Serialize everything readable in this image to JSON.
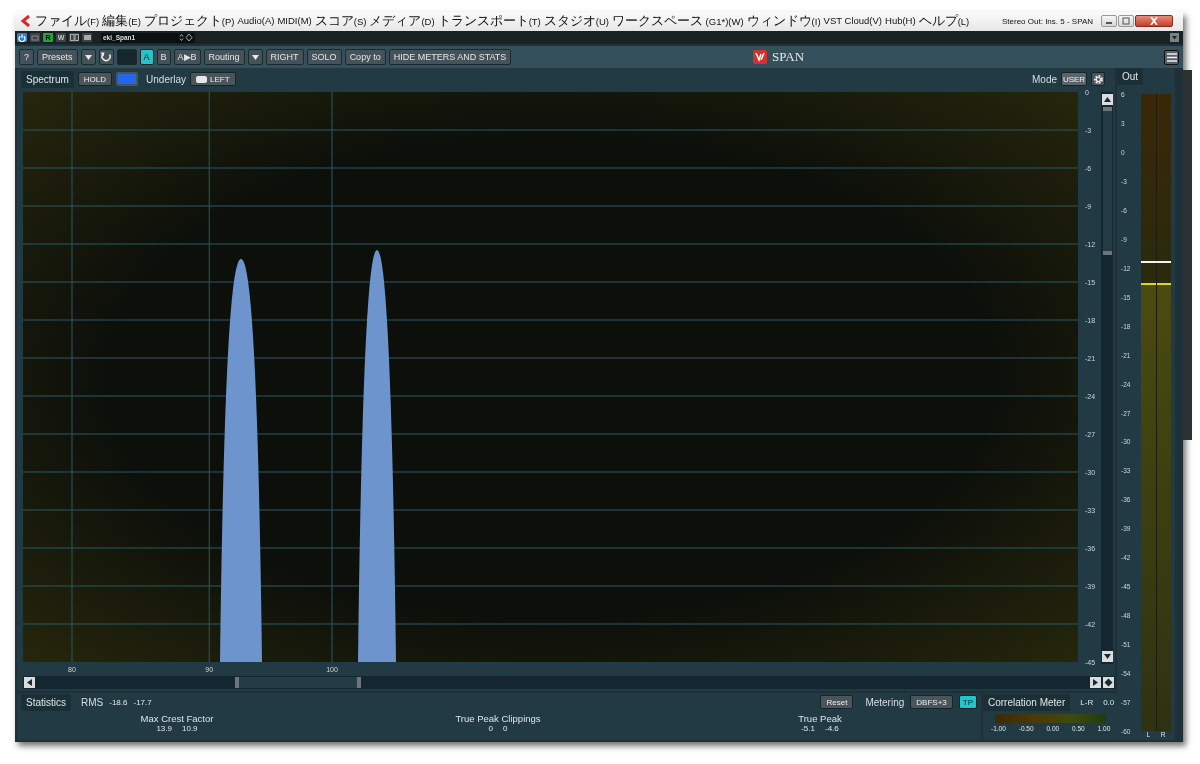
{
  "menu_bar": {
    "items": [
      "ファイル(F)",
      "編集(E)",
      "プロジェクト(P)",
      "Audio(A)",
      "MIDI(M)",
      "スコア(S)",
      "メディア(D)",
      "トランスポート(T)",
      "スタジオ(U)",
      "ワークスペース (G1*)(W)",
      "ウィンドウ(I)",
      "VST Cloud(V)",
      "Hub(H)",
      "ヘルプ(L)"
    ],
    "title": "Stereo Out: Ins. 5 - SPAN"
  },
  "host_toolbar": {
    "power_on": true,
    "automation": [
      {
        "label": "R",
        "on": true
      },
      {
        "label": "W",
        "on": false
      }
    ],
    "preset_name": "eki_Span1"
  },
  "plugin_toolbar": {
    "items": [
      {
        "kind": "button",
        "label": "?"
      },
      {
        "kind": "button",
        "label": "Presets"
      },
      {
        "kind": "caret"
      },
      {
        "kind": "reset"
      },
      {
        "kind": "blank"
      },
      {
        "kind": "slot",
        "label": "A",
        "selected": true
      },
      {
        "kind": "slot",
        "label": "B",
        "selected": false
      },
      {
        "kind": "slot",
        "label": "A▶B",
        "selected": false
      },
      {
        "kind": "button",
        "label": "Routing"
      },
      {
        "kind": "caret"
      },
      {
        "kind": "button",
        "label": "RIGHT"
      },
      {
        "kind": "button",
        "label": "SOLO"
      },
      {
        "kind": "button",
        "label": "Copy to"
      },
      {
        "kind": "button",
        "label": "HIDE METERS AND STATS"
      }
    ],
    "logo": "SPAN"
  },
  "spectrum": {
    "tab": "Spectrum",
    "hold": "HOLD",
    "underlay_label": "Underlay",
    "underlay": "LEFT",
    "mode_label": "Mode",
    "mode": "USER",
    "db_scale": [
      "0",
      "-3",
      "-6",
      "-9",
      "-12",
      "-15",
      "-18",
      "-21",
      "-24",
      "-27",
      "-30",
      "-33",
      "-36",
      "-39",
      "-42",
      "-45"
    ],
    "freq_scale": [
      "80",
      "90",
      "100"
    ]
  },
  "statistics": {
    "tab": "Statistics",
    "rms": {
      "label": "RMS",
      "values": [
        "-18.6",
        "-17.7"
      ]
    },
    "reset": "Reset",
    "metering_label": "Metering",
    "metering": "DBFS+3",
    "true_peak_mode": {
      "label": "TP",
      "on": true
    },
    "columns": [
      {
        "label": "Max Crest Factor",
        "values": [
          "13.9",
          "10.9"
        ]
      },
      {
        "label": "True Peak Clippings",
        "values": [
          "0",
          "0"
        ]
      },
      {
        "label": "True Peak",
        "values": [
          "-5.1",
          "-4.6"
        ]
      }
    ]
  },
  "correlation": {
    "tab": "Correlation Meter",
    "mode": "L-R",
    "value": "0.0",
    "scale": [
      "-1.00",
      "-0.50",
      "0.00",
      "0.50",
      "1.00"
    ]
  },
  "out_meter": {
    "tab": "Out",
    "scale": [
      "6",
      "3",
      "0",
      "-3",
      "-6",
      "-9",
      "-12",
      "-15",
      "-18",
      "-21",
      "-24",
      "-27",
      "-30",
      "-33",
      "-36",
      "-39",
      "-42",
      "-45",
      "-48",
      "-51",
      "-54",
      "-57",
      "-60"
    ],
    "channels": [
      {
        "label": "L",
        "level": 0.7
      },
      {
        "label": "R",
        "level": 0.7
      }
    ],
    "peak_hold": {
      "level": 0.735
    }
  }
}
